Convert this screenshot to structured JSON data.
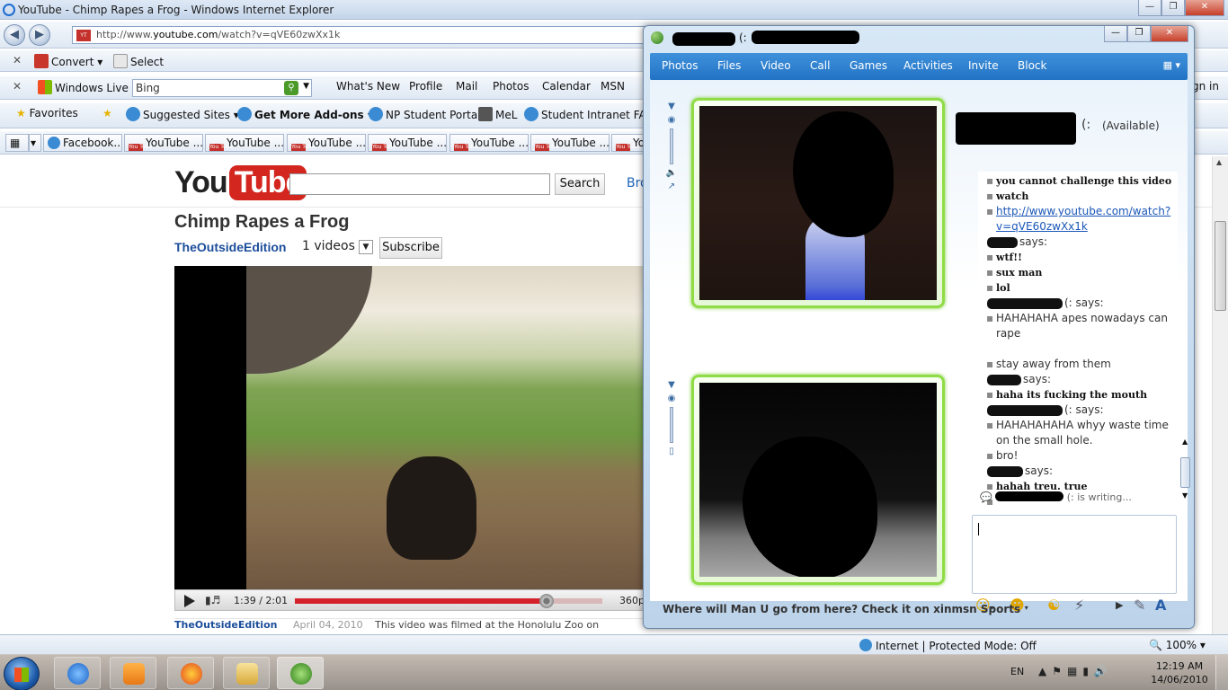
{
  "ie": {
    "title": "YouTube - Chimp Rapes a Frog - Windows Internet Explorer",
    "url_prefix": "http://www.",
    "url_domain": "youtube.com",
    "url_path": "/watch?v=qVE60zwXx1k",
    "toolbar1": {
      "convert": "Convert",
      "select": "Select"
    },
    "toolbar2": {
      "windows_live": "Windows Live",
      "search_value": "Bing",
      "links": [
        "What's New",
        "Profile",
        "Mail",
        "Photos",
        "Calendar",
        "MSN"
      ],
      "sign_in": "gn in"
    },
    "favorites": {
      "favorites": "Favorites",
      "suggested": "Suggested Sites",
      "addons": "Get More Add-ons",
      "np": "NP Student Portal",
      "mel": "MeL",
      "intranet": "Student Intranet FAQ"
    },
    "tabs": [
      "Facebook...",
      "YouTube ...",
      "YouTube ...",
      "YouTube ...",
      "YouTube ...",
      "YouTube ...",
      "YouTube ...",
      "Yo"
    ],
    "youtube_fav": "You Tube",
    "status": {
      "zone": "Internet | Protected Mode: Off",
      "zoom": "100%"
    }
  },
  "youtube": {
    "logo_you": "You",
    "logo_tube": "Tube",
    "search_button": "Search",
    "browse": "Bro",
    "video_title": "Chimp Rapes a Frog",
    "channel": "TheOutsideEdition",
    "videos_count": "1 videos",
    "subscribe": "Subscribe",
    "time": "1:39 / 2:01",
    "progress": 0.818,
    "quality": "360p",
    "info_author": "TheOutsideEdition",
    "info_date": "April 04, 2010",
    "info_desc": "This video was filmed at the Honolulu Zoo on"
  },
  "msn": {
    "title_sep": "(:",
    "menu": [
      "Photos",
      "Files",
      "Video",
      "Call",
      "Games",
      "Activities",
      "Invite",
      "Block"
    ],
    "contact_suffix": "(:",
    "availability": "(Available)",
    "chat": [
      {
        "kind": "text",
        "bold": true,
        "text": "you cannot challenge this video"
      },
      {
        "kind": "text",
        "bold": true,
        "text": "watch"
      },
      {
        "kind": "link",
        "text": "http://www.youtube.com/watch?"
      },
      {
        "kind": "link",
        "text": "v=qVE60zwXx1k"
      },
      {
        "kind": "says",
        "text": "says:"
      },
      {
        "kind": "text",
        "bold": true,
        "text": "wtf!!"
      },
      {
        "kind": "text",
        "bold": true,
        "text": "sux man"
      },
      {
        "kind": "text",
        "bold": true,
        "text": "lol"
      },
      {
        "kind": "says",
        "text": "(: says:"
      },
      {
        "kind": "text",
        "bold": false,
        "text": "HAHAHAHA apes nowadays can"
      },
      {
        "kind": "text",
        "bold": false,
        "text": "rape"
      },
      {
        "kind": "text",
        "bold": false,
        "text": "stay away from them"
      },
      {
        "kind": "says",
        "text": "says:"
      },
      {
        "kind": "text",
        "bold": true,
        "text": "haha its fucking the mouth"
      },
      {
        "kind": "says",
        "text": "(: says:"
      },
      {
        "kind": "text",
        "bold": false,
        "text": "HAHAHAHAHA whyy waste time"
      },
      {
        "kind": "text",
        "bold": false,
        "text": "on the small hole."
      },
      {
        "kind": "text",
        "bold": false,
        "text": "bro!"
      },
      {
        "kind": "says",
        "text": "says:"
      },
      {
        "kind": "text",
        "bold": true,
        "text": "hahah treu. true"
      }
    ],
    "writing": "(: is writing...",
    "ad": "Where will Man U go from here? Check it on xinmsn Sports"
  },
  "taskbar": {
    "lang": "EN",
    "time": "12:19 AM",
    "date": "14/06/2010"
  },
  "colors": {
    "youtube_red": "#d3261f",
    "msn_menu": "#2f82d0",
    "cam_border": "#8fdc46"
  }
}
